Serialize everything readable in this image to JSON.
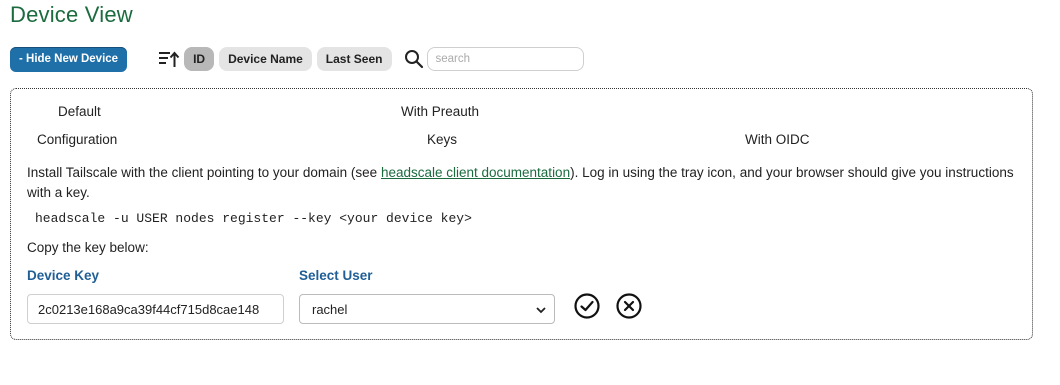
{
  "page": {
    "title": "Device View"
  },
  "toolbar": {
    "hide_button": "- Hide New Device",
    "sort_icon": "sort-ascending-icon",
    "sort_options": [
      "ID",
      "Device Name",
      "Last Seen"
    ],
    "active_sort": "ID",
    "search_icon": "search-icon",
    "search_placeholder": "search",
    "search_value": ""
  },
  "panel": {
    "options": {
      "default_line1": "Default",
      "default_line2": "Configuration",
      "preauth_line1": "With Preauth",
      "preauth_line2": "Keys",
      "oidc": "With OIDC"
    },
    "description_before": "Install Tailscale with the client pointing to your domain (see ",
    "description_link": "headscale client documentation",
    "description_after": "). Log in using the tray icon, and your browser should give you instructions with a key.",
    "command": "headscale -u USER nodes register --key <your device key>",
    "copy_label": "Copy the key below:",
    "device_key_label": "Device Key",
    "device_key_value": "2c0213e168a9ca39f44cf715d8cae148",
    "select_user_label": "Select User",
    "selected_user": "rachel",
    "confirm_icon": "check-circle-icon",
    "cancel_icon": "close-circle-icon"
  },
  "colors": {
    "title": "#1b6b3f",
    "primary_button": "#1f6fa8",
    "field_label": "#1f5f96",
    "link": "#1b6b3f"
  }
}
